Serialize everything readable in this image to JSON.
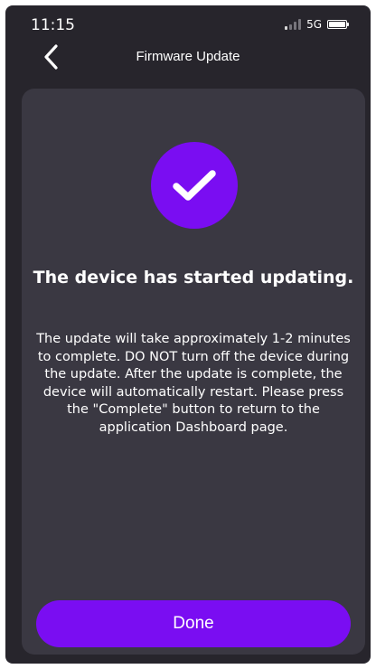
{
  "status_bar": {
    "time": "11:15",
    "network": "5G",
    "icons": [
      "signal-icon",
      "battery-icon"
    ]
  },
  "nav": {
    "back_icon": "chevron-left-icon",
    "title": "Firmware Update"
  },
  "card": {
    "icon": "checkmark-icon",
    "title": "The device has started updating.",
    "message": "The update will take approximately 1-2 minutes to complete. DO NOT turn off the device during the update. After the update is complete, the device will automatically restart. Please press the \"Complete\" button to return to the application Dashboard page.",
    "done_label": "Done"
  },
  "colors": {
    "background": "#27252c",
    "card": "#3a3842",
    "accent": "#7a0df2",
    "text": "#ffffff"
  }
}
